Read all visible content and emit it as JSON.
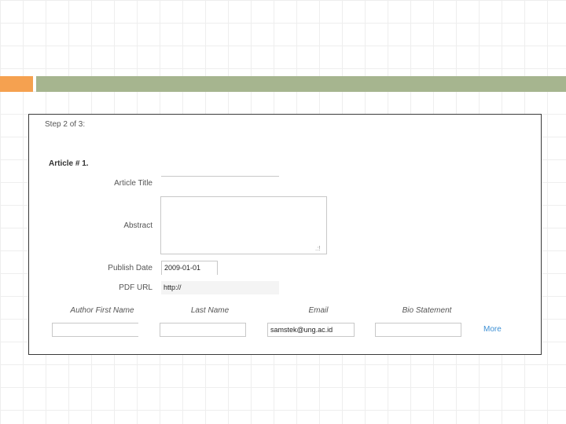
{
  "form": {
    "step": "Step 2 of 3:",
    "article_heading": "Article # 1.",
    "labels": {
      "title": "Article Title",
      "abstract": "Abstract",
      "publish_date": "Publish Date",
      "pdf_url": "PDF URL"
    },
    "values": {
      "title": "",
      "abstract": "",
      "publish_date": "2009-01-01",
      "pdf_url": "http://"
    },
    "author_columns": [
      "Author First Name",
      "Last Name",
      "Email",
      "Bio Statement"
    ],
    "author_row": {
      "first_name": "",
      "last_name": "",
      "email": "samstek@ung.ac.id",
      "bio": ""
    },
    "more_link": "More"
  },
  "colors": {
    "accent_orange": "#f5a150",
    "accent_green": "#a6b58f",
    "link_blue": "#3c8fd4"
  }
}
